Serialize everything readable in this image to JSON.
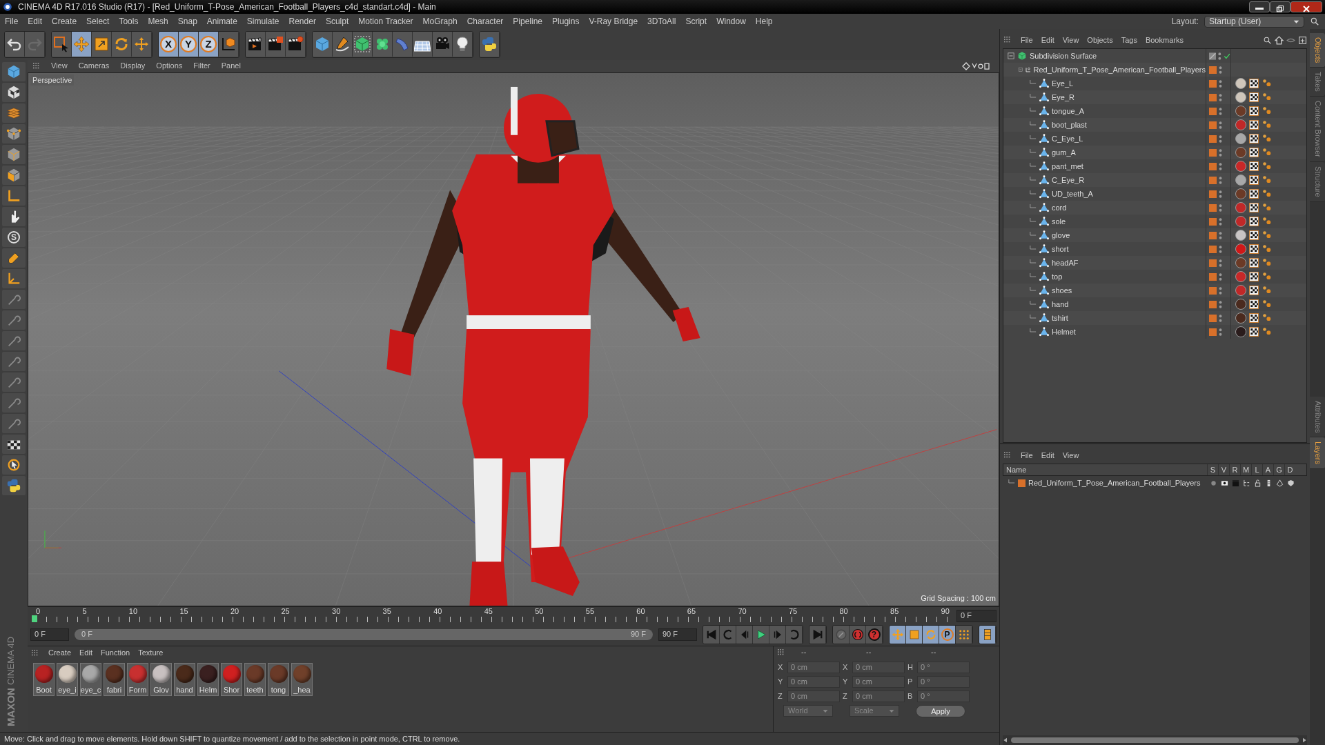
{
  "title_bar": {
    "title": "CINEMA 4D R17.016 Studio (R17) - [Red_Uniform_T-Pose_American_Football_Players_c4d_standart.c4d] - Main"
  },
  "menu_bar": [
    "File",
    "Edit",
    "Create",
    "Select",
    "Tools",
    "Mesh",
    "Snap",
    "Animate",
    "Simulate",
    "Render",
    "Sculpt",
    "Motion Tracker",
    "MoGraph",
    "Character",
    "Pipeline",
    "Plugins",
    "V-Ray Bridge",
    "3DToAll",
    "Script",
    "Window",
    "Help"
  ],
  "layout": {
    "label": "Layout:",
    "value": "Startup (User)"
  },
  "toolbar": [
    [
      {
        "kind": "undo",
        "selected": false
      },
      {
        "kind": "redo",
        "selected": false
      }
    ],
    [
      {
        "kind": "select",
        "selected": false
      },
      {
        "kind": "move",
        "selected": true
      },
      {
        "kind": "scale",
        "selected": false
      },
      {
        "kind": "rotate",
        "selected": false
      },
      {
        "kind": "transform",
        "selected": false
      }
    ],
    [
      {
        "kind": "axis",
        "label": "X",
        "selected": true
      },
      {
        "kind": "axis",
        "label": "Y",
        "selected": true
      },
      {
        "kind": "axis",
        "label": "Z",
        "selected": true
      },
      {
        "kind": "coord",
        "selected": false
      }
    ],
    [
      {
        "kind": "render-view",
        "selected": false
      },
      {
        "kind": "render",
        "selected": false
      },
      {
        "kind": "render-settings",
        "selected": false
      }
    ],
    [
      {
        "kind": "cube",
        "selected": false
      },
      {
        "kind": "pen",
        "selected": false
      },
      {
        "kind": "subdiv",
        "selected": false
      },
      {
        "kind": "cloner",
        "selected": false
      },
      {
        "kind": "deformer",
        "selected": false
      },
      {
        "kind": "floor",
        "selected": false
      },
      {
        "kind": "camera",
        "selected": false
      },
      {
        "kind": "light",
        "selected": false
      }
    ],
    [
      {
        "kind": "script",
        "selected": false
      }
    ]
  ],
  "left_tools": [
    {
      "kind": "cube"
    },
    {
      "kind": "checker-cube"
    },
    {
      "kind": "plane-stack"
    },
    {
      "kind": "cube-points"
    },
    {
      "kind": "cube-edges"
    },
    {
      "kind": "cube-faces"
    },
    {
      "kind": "angle"
    },
    {
      "kind": "brush"
    },
    {
      "kind": "letter",
      "label": "S"
    },
    {
      "kind": "magnet"
    },
    {
      "kind": "axis"
    },
    {
      "kind": "tool"
    },
    {
      "kind": "tool"
    },
    {
      "kind": "tool"
    },
    {
      "kind": "tool"
    },
    {
      "kind": "tool"
    },
    {
      "kind": "tool"
    },
    {
      "kind": "tool"
    },
    {
      "kind": "checker-plane"
    },
    {
      "kind": "tweak"
    },
    {
      "kind": "script"
    }
  ],
  "viewport": {
    "menu": [
      "View",
      "Cameras",
      "Display",
      "Options",
      "Filter",
      "Panel"
    ],
    "camera": "Perspective",
    "grid_spacing": "Grid Spacing : 100 cm"
  },
  "object_manager": {
    "menu": [
      "File",
      "Edit",
      "View",
      "Objects",
      "Tags",
      "Bookmarks"
    ],
    "tree": [
      {
        "name": "Subdivision Surface",
        "kind": "subdiv",
        "enabled": true,
        "children": [
          {
            "name": "Red_Uniform_T_Pose_American_Football_Players",
            "kind": "null",
            "children": [
              {
                "name": "Eye_L",
                "kind": "mesh",
                "material": {
                  "color": "#cfc6bb"
                }
              },
              {
                "name": "Eye_R",
                "kind": "mesh",
                "material": {
                  "color": "#cfc6bb"
                }
              },
              {
                "name": "tongue_A",
                "kind": "mesh",
                "material": {
                  "color": "#6b3a26"
                }
              },
              {
                "name": "boot_plast",
                "kind": "mesh",
                "material": {
                  "color": "#c02828"
                }
              },
              {
                "name": "C_Eye_L",
                "kind": "mesh",
                "material": {
                  "color": "#a8a8a8"
                }
              },
              {
                "name": "gum_A",
                "kind": "mesh",
                "material": {
                  "color": "#6b3a26"
                }
              },
              {
                "name": "pant_met",
                "kind": "mesh",
                "material": {
                  "color": "#c82828"
                }
              },
              {
                "name": "C_Eye_R",
                "kind": "mesh",
                "material": {
                  "color": "#a8a8a8"
                }
              },
              {
                "name": "UD_teeth_A",
                "kind": "mesh",
                "material": {
                  "color": "#6b3a26"
                }
              },
              {
                "name": "cord",
                "kind": "mesh",
                "material": {
                  "color": "#c02828"
                }
              },
              {
                "name": "sole",
                "kind": "mesh",
                "material": {
                  "color": "#c02828"
                }
              },
              {
                "name": "glove",
                "kind": "mesh",
                "material": {
                  "color": "#c8c4c4"
                }
              },
              {
                "name": "short",
                "kind": "mesh",
                "material": {
                  "color": "#d01818"
                }
              },
              {
                "name": "headAF",
                "kind": "mesh",
                "material": {
                  "color": "#6b3a26"
                }
              },
              {
                "name": "top",
                "kind": "mesh",
                "material": {
                  "color": "#c82828"
                }
              },
              {
                "name": "shoes",
                "kind": "mesh",
                "material": {
                  "color": "#c02828"
                }
              },
              {
                "name": "hand",
                "kind": "mesh",
                "material": {
                  "color": "#4a2a1e"
                }
              },
              {
                "name": "tshirt",
                "kind": "mesh",
                "material": {
                  "color": "#4a2a1e"
                }
              },
              {
                "name": "Helmet",
                "kind": "mesh",
                "material": {
                  "color": "#2a1c1c"
                }
              }
            ]
          }
        ]
      }
    ]
  },
  "side_tabs_top": [
    {
      "label": "Objects",
      "selected": true
    },
    {
      "label": "Takes",
      "selected": false
    },
    {
      "label": "Content Browser",
      "selected": false
    },
    {
      "label": "Structure",
      "selected": false
    }
  ],
  "layer_manager": {
    "menu": [
      "File",
      "Edit",
      "View"
    ],
    "columns": [
      "Name",
      "S",
      "V",
      "R",
      "M",
      "L",
      "A",
      "G",
      "D"
    ],
    "rows": [
      {
        "name": "Red_Uniform_T_Pose_American_Football_Players"
      }
    ]
  },
  "side_tabs_bottom": [
    {
      "label": "Attributes",
      "selected": false
    },
    {
      "label": "Layers",
      "selected": true
    }
  ],
  "timeline": {
    "level": 1,
    "ticks": [
      "0",
      "5",
      "10",
      "15",
      "20",
      "25",
      "30",
      "35",
      "40",
      "45",
      "50",
      "55",
      "60",
      "65",
      "70",
      "75",
      "80",
      "85",
      "90"
    ],
    "current_frame": "0 F",
    "start": "0 F",
    "range_start": "0 F",
    "range_end": "90 F",
    "end": "90 F"
  },
  "transport": [
    [
      {
        "kind": "first"
      },
      {
        "kind": "prev-key"
      },
      {
        "kind": "prev-frame"
      },
      {
        "kind": "play"
      },
      {
        "kind": "next-frame"
      },
      {
        "kind": "next-key"
      }
    ],
    [
      {
        "kind": "last"
      }
    ],
    [
      {
        "kind": "keyframe-off"
      },
      {
        "kind": "record"
      },
      {
        "kind": "autokey",
        "label": "?"
      }
    ],
    [
      {
        "kind": "key-move",
        "selected": true
      },
      {
        "kind": "key-scale",
        "selected": true
      },
      {
        "kind": "key-rotate",
        "selected": true
      },
      {
        "kind": "key-param",
        "label": "P",
        "selected": true
      },
      {
        "kind": "key-points",
        "selected": false
      }
    ],
    [
      {
        "kind": "timeline-window",
        "selected": true
      }
    ]
  ],
  "material_manager": {
    "menu": [
      "Create",
      "Edit",
      "Function",
      "Texture"
    ],
    "materials": [
      {
        "name": "Boot",
        "color": "#b82222"
      },
      {
        "name": "eye_i",
        "color": "#d8ccc0"
      },
      {
        "name": "eye_c",
        "color": "#a8a8a8"
      },
      {
        "name": "fabri",
        "color": "#5a3020"
      },
      {
        "name": "Form",
        "color": "#c83030"
      },
      {
        "name": "Glov",
        "color": "#c8c0c0"
      },
      {
        "name": "hand",
        "color": "#4a2a1a"
      },
      {
        "name": "Helm",
        "color": "#3a2020"
      },
      {
        "name": "Shor",
        "color": "#d02020"
      },
      {
        "name": "teeth",
        "color": "#6a3a28"
      },
      {
        "name": "tong",
        "color": "#6a3a28"
      },
      {
        "name": "_hea",
        "color": "#70402a"
      }
    ]
  },
  "coordinates": {
    "headers": [
      "--",
      "--",
      "--"
    ],
    "rows": [
      [
        {
          "axis": "X",
          "value": "0 cm"
        },
        {
          "axis": "X",
          "value": "0 cm"
        },
        {
          "axis": "H",
          "value": "0 °"
        }
      ],
      [
        {
          "axis": "Y",
          "value": "0 cm"
        },
        {
          "axis": "Y",
          "value": "0 cm"
        },
        {
          "axis": "P",
          "value": "0 °"
        }
      ],
      [
        {
          "axis": "Z",
          "value": "0 cm"
        },
        {
          "axis": "Z",
          "value": "0 cm"
        },
        {
          "axis": "B",
          "value": "0 °"
        }
      ]
    ],
    "dropdowns": [
      "World",
      "Scale"
    ],
    "apply": "Apply"
  },
  "logo": {
    "brand": "MAXON",
    "product": "CINEMA 4D"
  },
  "status_bar": "Move: Click and drag to move elements. Hold down SHIFT to quantize movement / add to the selection in point mode, CTRL to remove."
}
